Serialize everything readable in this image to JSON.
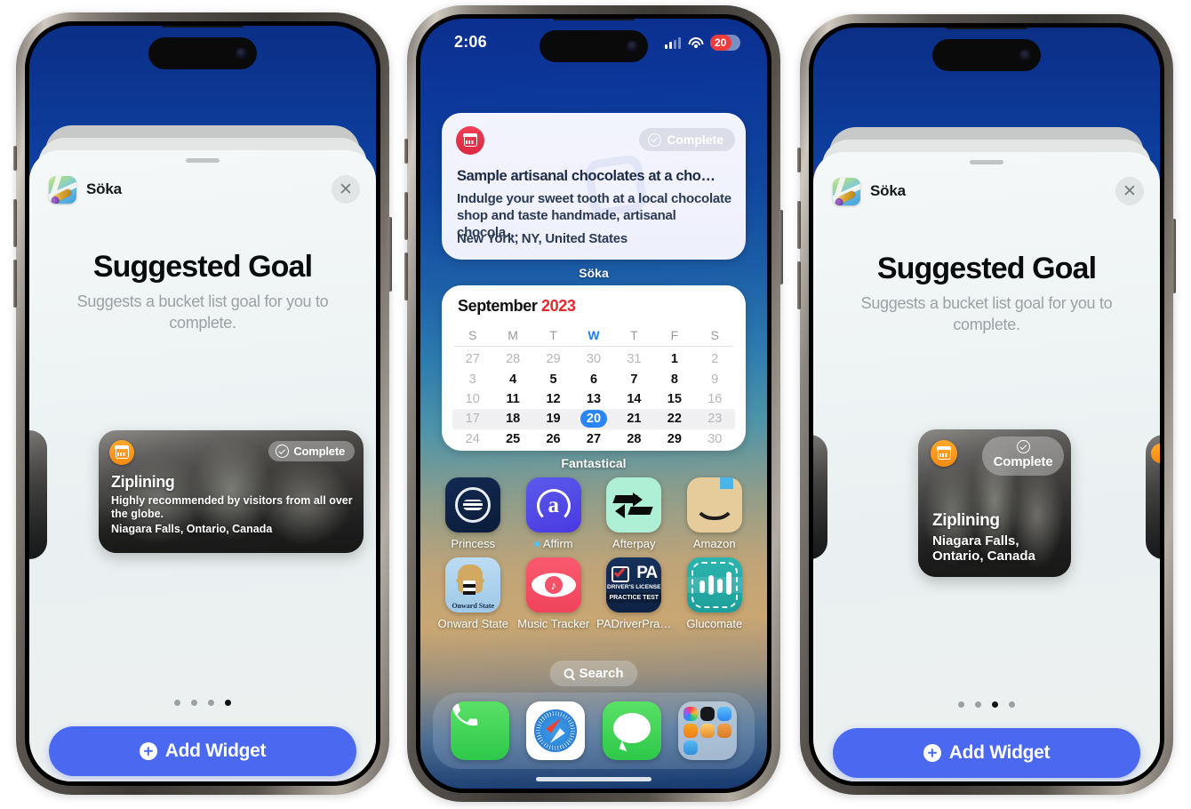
{
  "phones": {
    "left": {
      "sheet": {
        "app_name": "Söka",
        "close_icon": "close-icon",
        "title": "Suggested Goal",
        "subtitle": "Suggests a bucket list goal for you to complete.",
        "add_button_label": "Add Widget",
        "page_dots": {
          "count": 4,
          "active_index": 3
        }
      },
      "widget_preview": {
        "size": "medium",
        "badge_icon": "calendar-icon",
        "status_label": "Complete",
        "status_icon": "check-circle-icon",
        "title": "Ziplining",
        "description": "Highly recommended by visitors from all over the globe.",
        "location": "Niagara Falls, Ontario, Canada"
      }
    },
    "middle": {
      "status_bar": {
        "time": "2:06",
        "cellular_icon": "signal-bars-icon",
        "wifi_icon": "wifi-icon",
        "battery_level": "20",
        "battery_color": "#ee3b3b"
      },
      "note_widget": {
        "icon": "calendar-icon",
        "status_label": "Complete",
        "status_icon": "check-circle-icon",
        "title": "Sample artisanal chocolates at a cho…",
        "description": "Indulge your sweet tooth at a local chocolate shop and taste handmade, artisanal chocola…",
        "location": "New York, NY, United States",
        "label": "Söka"
      },
      "calendar_widget": {
        "month": "September",
        "year": "2023",
        "dow": [
          "S",
          "M",
          "T",
          "W",
          "T",
          "F",
          "S"
        ],
        "highlight_dow_index": 3,
        "weeks": [
          [
            {
              "d": "27",
              "dim": true
            },
            {
              "d": "28",
              "dim": true
            },
            {
              "d": "29",
              "dim": true
            },
            {
              "d": "30",
              "dim": true
            },
            {
              "d": "31",
              "dim": true
            },
            {
              "d": "1",
              "dim": false
            },
            {
              "d": "2",
              "dim": true
            }
          ],
          [
            {
              "d": "3",
              "dim": true
            },
            {
              "d": "4",
              "dim": false
            },
            {
              "d": "5",
              "dim": false
            },
            {
              "d": "6",
              "dim": false
            },
            {
              "d": "7",
              "dim": false
            },
            {
              "d": "8",
              "dim": false
            },
            {
              "d": "9",
              "dim": true
            }
          ],
          [
            {
              "d": "10",
              "dim": true
            },
            {
              "d": "11",
              "dim": false
            },
            {
              "d": "12",
              "dim": false
            },
            {
              "d": "13",
              "dim": false
            },
            {
              "d": "14",
              "dim": false
            },
            {
              "d": "15",
              "dim": false
            },
            {
              "d": "16",
              "dim": true
            }
          ],
          [
            {
              "d": "17",
              "dim": true
            },
            {
              "d": "18",
              "dim": false
            },
            {
              "d": "19",
              "dim": false
            },
            {
              "d": "20",
              "dim": false,
              "today": true
            },
            {
              "d": "21",
              "dim": false
            },
            {
              "d": "22",
              "dim": false
            },
            {
              "d": "23",
              "dim": true
            }
          ],
          [
            {
              "d": "24",
              "dim": true
            },
            {
              "d": "25",
              "dim": false
            },
            {
              "d": "26",
              "dim": false
            },
            {
              "d": "27",
              "dim": false
            },
            {
              "d": "28",
              "dim": false
            },
            {
              "d": "29",
              "dim": false
            },
            {
              "d": "30",
              "dim": true
            }
          ]
        ],
        "highlight_week_index": 3,
        "label": "Fantastical"
      },
      "apps": [
        {
          "label": "Princess",
          "icon": "princess-cruises-icon",
          "badge": false
        },
        {
          "label": "Affirm",
          "icon": "affirm-icon",
          "badge": true
        },
        {
          "label": "Afterpay",
          "icon": "afterpay-icon",
          "badge": false
        },
        {
          "label": "Amazon",
          "icon": "amazon-icon",
          "badge": false
        },
        {
          "label": "Onward State",
          "icon": "onward-state-icon",
          "badge": false
        },
        {
          "label": "Music Tracker",
          "icon": "music-tracker-icon",
          "badge": false
        },
        {
          "label": "PADriverPra…",
          "icon": "pa-driver-practice-icon",
          "badge": false
        },
        {
          "label": "Glucomate",
          "icon": "glucomate-icon",
          "badge": false
        }
      ],
      "search_label": "Search",
      "search_icon": "search-icon",
      "dock": [
        {
          "name": "phone-app-icon"
        },
        {
          "name": "safari-app-icon"
        },
        {
          "name": "messages-app-icon"
        },
        {
          "name": "app-folder-icon"
        }
      ]
    },
    "right": {
      "sheet": {
        "app_name": "Söka",
        "close_icon": "close-icon",
        "title": "Suggested Goal",
        "subtitle": "Suggests a bucket list goal for you to complete.",
        "add_button_label": "Add Widget",
        "page_dots": {
          "count": 4,
          "active_index": 2
        }
      },
      "widget_preview": {
        "size": "small",
        "badge_icon": "calendar-icon",
        "status_label": "Complete",
        "status_icon": "check-circle-icon",
        "title": "Ziplining",
        "location_line1": "Niagara Falls,",
        "location_line2": "Ontario, Canada"
      }
    }
  },
  "colors": {
    "accent_blue": "#4a69f0",
    "today_blue": "#2a86f7",
    "year_red": "#e8262e",
    "badge_orange": "#f79211",
    "note_icon_red": "#e23247"
  }
}
